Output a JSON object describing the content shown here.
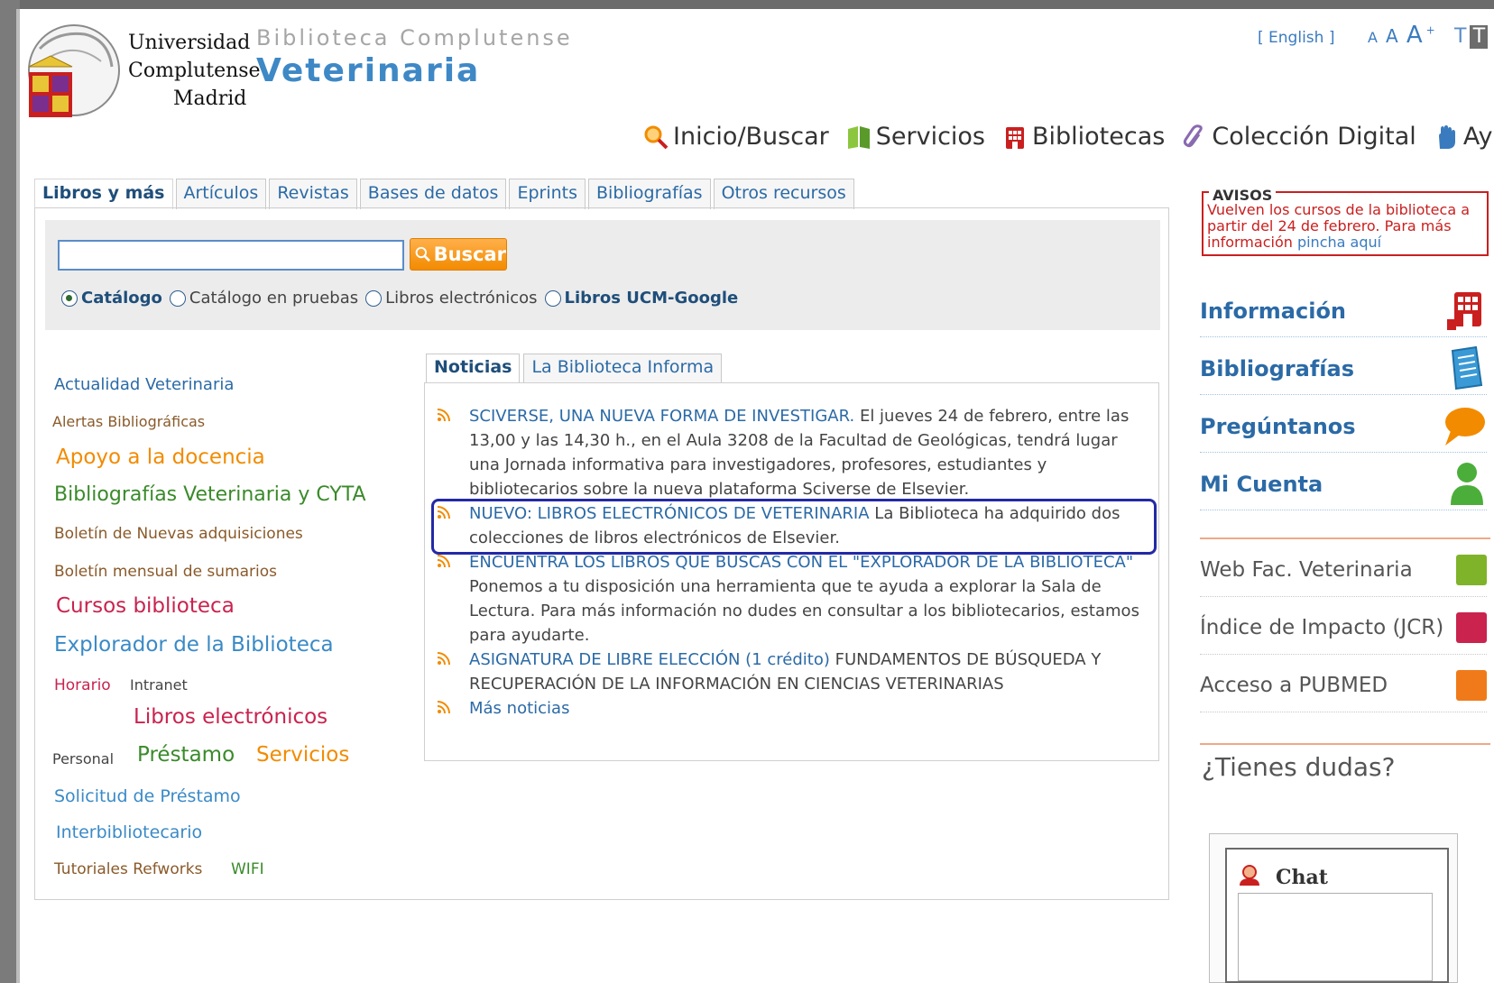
{
  "header": {
    "univ_line1": "Universidad",
    "univ_line2": "Complutense",
    "univ_line3": "Madrid",
    "subtitle": "Biblioteca Complutense",
    "title": "Veterinaria",
    "language_link": "[ English ]",
    "font_small": "A",
    "font_medium": "A",
    "font_large": "A",
    "font_large_sup": "+",
    "contrast_normal": "T",
    "contrast_high": "T"
  },
  "main_nav": [
    {
      "label": "Inicio/Buscar",
      "icon": "search-icon",
      "color": "#f28b00"
    },
    {
      "label": "Servicios",
      "icon": "book-icon",
      "color": "#6aa33a"
    },
    {
      "label": "Bibliotecas",
      "icon": "building-icon",
      "color": "#c9201f"
    },
    {
      "label": "Colección Digital",
      "icon": "clip-icon",
      "color": "#8a6ab0"
    },
    {
      "label": "Ayuda",
      "icon": "hand-icon",
      "color": "#3a7bbf"
    }
  ],
  "search_tabs": [
    {
      "label": "Libros y más",
      "active": true
    },
    {
      "label": "Artículos"
    },
    {
      "label": "Revistas"
    },
    {
      "label": "Bases de datos"
    },
    {
      "label": "Eprints"
    },
    {
      "label": "Bibliografías"
    },
    {
      "label": "Otros recursos"
    }
  ],
  "search": {
    "value": "",
    "button_label": "Buscar",
    "options": [
      {
        "label": "Catálogo",
        "selected": true
      },
      {
        "label": "Catálogo en pruebas"
      },
      {
        "label": "Libros electrónicos"
      },
      {
        "label": "Libros UCM-Google"
      }
    ]
  },
  "left_links": {
    "actualidad": "Actualidad Veterinaria",
    "alertas": "Alertas Bibliográficas",
    "apoyo": "Apoyo a la docencia",
    "bibliografias": "Bibliografías Veterinaria y CYTA",
    "boletin_nuevas": "Boletín de Nuevas adquisiciones",
    "boletin_sumarios": "Boletín mensual de sumarios",
    "cursos": "Cursos biblioteca",
    "explorador": "Explorador de la Biblioteca",
    "horario": "Horario",
    "intranet": "Intranet",
    "libros_electronicos": "Libros electrónicos",
    "personal": "Personal",
    "prestamo": "Préstamo",
    "servicios": "Servicios",
    "solicitud": "Solicitud de Préstamo",
    "interbibliotecario": "Interbibliotecario",
    "tutoriales": "Tutoriales Refworks",
    "wifi": "WIFI"
  },
  "news_tabs": [
    {
      "label": "Noticias",
      "active": true
    },
    {
      "label": "La Biblioteca Informa"
    }
  ],
  "news": [
    {
      "link": "SCIVERSE, UNA NUEVA FORMA DE INVESTIGAR.",
      "text": " El jueves 24 de febrero, entre las 13,00 y las 14,30 h., en el Aula 3208 de la Facultad de Geológicas, tendrá lugar una Jornada informativa para investigadores, profesores, estudiantes y bibliotecarios sobre la nueva plataforma Sciverse de Elsevier."
    },
    {
      "link": "NUEVO: LIBROS ELECTRÓNICOS DE VETERINARIA",
      "text": " La Biblioteca ha adquirido dos colecciones de libros electrónicos de Elsevier."
    },
    {
      "link": "ENCUENTRA LOS LIBROS QUE BUSCAS CON EL \"EXPLORADOR DE LA BIBLIOTECA\"",
      "text": " Ponemos a tu disposición una herramienta que te ayuda a explorar la Sala de Lectura. Para más información no dudes en consultar a los bibliotecarios, estamos para ayudarte."
    },
    {
      "link": "ASIGNATURA DE LIBRE ELECCIÓN (1 crédito)",
      "text": " FUNDAMENTOS DE BÚSQUEDA Y RECUPERACIÓN DE LA INFORMACIÓN EN CIENCIAS VETERINARIAS"
    },
    {
      "link": "Más noticias",
      "text": ""
    }
  ],
  "avisos": {
    "title": "AVISOS",
    "text": "Vuelven los cursos de la biblioteca a partir del 24 de febrero. Para más información ",
    "link": "pincha aquí"
  },
  "side_items": [
    {
      "label": "Información",
      "icon": "building-icon",
      "color": "#c9201f"
    },
    {
      "label": "Bibliografías",
      "icon": "document-icon",
      "color": "#3a9ad6"
    },
    {
      "label": "Pregúntanos",
      "icon": "speech-bubble-icon",
      "color": "#f28b00"
    },
    {
      "label": "Mi Cuenta",
      "icon": "user-icon",
      "color": "#4cae3a"
    }
  ],
  "side_links": [
    {
      "label": "Web Fac. Veterinaria",
      "color": "#7fb32a"
    },
    {
      "label": "Índice de Impacto (JCR)",
      "color": "#c9234e"
    },
    {
      "label": "Acceso a PUBMED",
      "color": "#f07a1a"
    }
  ],
  "help": {
    "question": "¿Tienes dudas?",
    "chat_label": "Chat"
  }
}
